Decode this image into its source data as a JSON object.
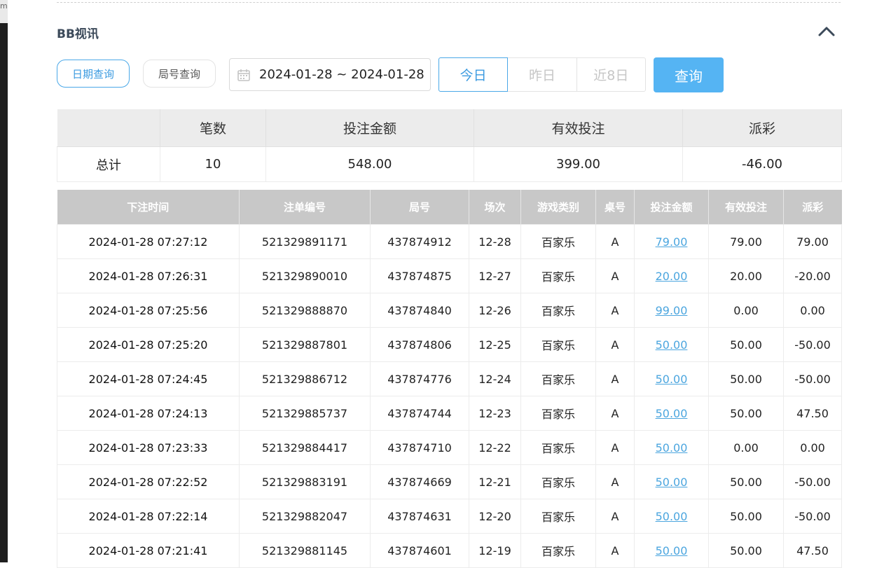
{
  "section": {
    "title": "BB视讯"
  },
  "left_strip": {
    "text": "ma"
  },
  "filters": {
    "date_query_label": "日期查询",
    "round_query_label": "局号查询",
    "date_range": "2024-01-28 ~ 2024-01-28",
    "quick": [
      "今日",
      "昨日",
      "近8日"
    ],
    "query_label": "查询"
  },
  "summary": {
    "headers": [
      "",
      "笔数",
      "投注金额",
      "有效投注",
      "派彩"
    ],
    "row": {
      "label": "总计",
      "count": "10",
      "bet": "548.00",
      "valid": "399.00",
      "payout": "-46.00"
    }
  },
  "detail": {
    "headers": [
      "下注时间",
      "注单编号",
      "局号",
      "场次",
      "游戏类别",
      "桌号",
      "投注金额",
      "有效投注",
      "派彩"
    ],
    "rows": [
      [
        "2024-01-28 07:27:12",
        "521329891171",
        "437874912",
        "12-28",
        "百家乐",
        "A",
        "79.00",
        "79.00",
        "79.00"
      ],
      [
        "2024-01-28 07:26:31",
        "521329890010",
        "437874875",
        "12-27",
        "百家乐",
        "A",
        "20.00",
        "20.00",
        "-20.00"
      ],
      [
        "2024-01-28 07:25:56",
        "521329888870",
        "437874840",
        "12-26",
        "百家乐",
        "A",
        "99.00",
        "0.00",
        "0.00"
      ],
      [
        "2024-01-28 07:25:20",
        "521329887801",
        "437874806",
        "12-25",
        "百家乐",
        "A",
        "50.00",
        "50.00",
        "-50.00"
      ],
      [
        "2024-01-28 07:24:45",
        "521329886712",
        "437874776",
        "12-24",
        "百家乐",
        "A",
        "50.00",
        "50.00",
        "-50.00"
      ],
      [
        "2024-01-28 07:24:13",
        "521329885737",
        "437874744",
        "12-23",
        "百家乐",
        "A",
        "50.00",
        "50.00",
        "47.50"
      ],
      [
        "2024-01-28 07:23:33",
        "521329884417",
        "437874710",
        "12-22",
        "百家乐",
        "A",
        "50.00",
        "0.00",
        "0.00"
      ],
      [
        "2024-01-28 07:22:52",
        "521329883191",
        "437874669",
        "12-21",
        "百家乐",
        "A",
        "50.00",
        "50.00",
        "-50.00"
      ],
      [
        "2024-01-28 07:22:14",
        "521329882047",
        "437874631",
        "12-20",
        "百家乐",
        "A",
        "50.00",
        "50.00",
        "-50.00"
      ],
      [
        "2024-01-28 07:21:41",
        "521329881145",
        "437874601",
        "12-19",
        "百家乐",
        "A",
        "50.00",
        "50.00",
        "47.50"
      ]
    ]
  },
  "colors": {
    "accent": "#55b4f3",
    "negative": "#e0384a",
    "link": "#4ca6df",
    "header_gray": "#c8c8c8"
  }
}
